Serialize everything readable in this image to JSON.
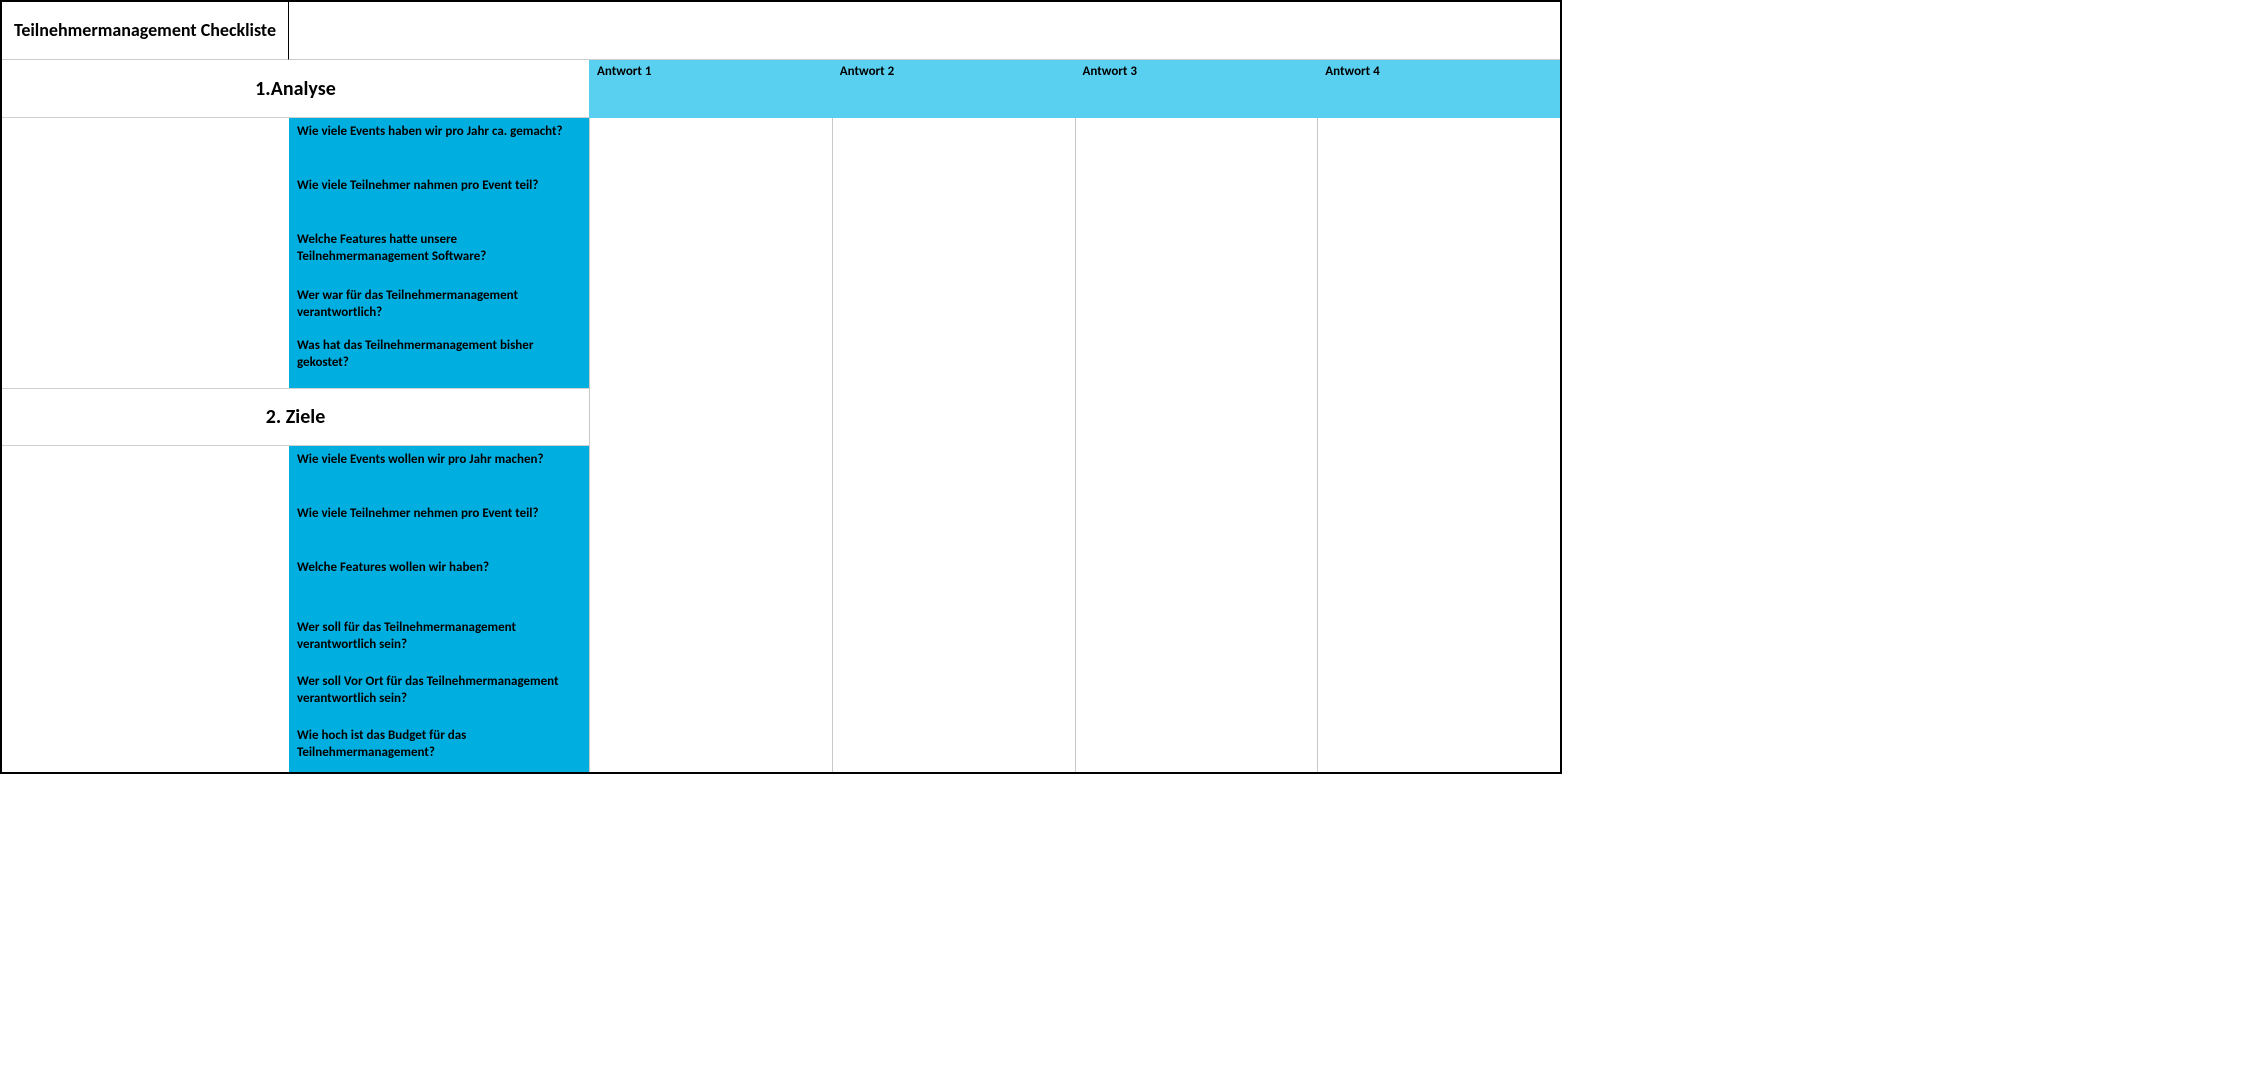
{
  "title": "Teilnehmermanagement Checkliste",
  "answer_headers": [
    "Antwort 1",
    "Antwort 2",
    "Antwort 3",
    "Antwort 4"
  ],
  "sections": [
    {
      "title": "1.Analyse",
      "questions": [
        "Wie viele Events haben wir pro Jahr ca. gemacht?",
        "Wie viele Teilnehmer nahmen pro Event teil?",
        "Welche Features hatte unsere Teilnehmermanagement Software?",
        "Wer war für das Teilnehmermanagement verantwortlich?",
        "Was hat das Teilnehmermanagement bisher gekostet?"
      ]
    },
    {
      "title": "2. Ziele",
      "questions": [
        "Wie viele Events wollen wir pro Jahr machen?",
        "Wie viele Teilnehmer nehmen pro Event teil?",
        "Welche Features wollen wir haben?",
        "Wer soll für das Teilnehmermanagement verantwortlich sein?",
        "Wer soll Vor Ort für das Teilnehmermanagement verantwortlich sein?",
        "Wie hoch ist das Budget für das Teilnehmermanagement?"
      ]
    }
  ]
}
